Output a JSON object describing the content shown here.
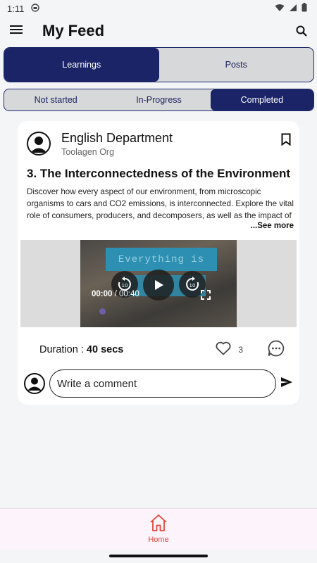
{
  "status": {
    "time": "1:11"
  },
  "header": {
    "title": "My Feed"
  },
  "main_tabs": [
    {
      "label": "Learnings",
      "active": true
    },
    {
      "label": "Posts",
      "active": false
    }
  ],
  "sub_tabs": [
    {
      "label": "Not started",
      "active": false
    },
    {
      "label": "In-Progress",
      "active": false
    },
    {
      "label": "Completed",
      "active": true
    }
  ],
  "post": {
    "author": "English Department",
    "org": "Toolagen Org",
    "title": "3. The Interconnectedness of the Environment",
    "description": "Discover how every aspect of our environment, from microscopic organisms to cars and CO2 emissions, is interconnected. Explore the vital role of consumers, producers, and decomposers, as well as the impact of human activities on our planet.",
    "see_more": "...See more",
    "video": {
      "banner_text": "Everything is",
      "current_time": "00:00",
      "separator": " / ",
      "total_time": "00:40",
      "rewind_seconds": "10",
      "forward_seconds": "10"
    },
    "duration_label": "Duration : ",
    "duration_value": "40 secs",
    "like_count": "3"
  },
  "comment": {
    "placeholder": "Write a comment"
  },
  "bottom_nav": {
    "home_label": "Home"
  },
  "colors": {
    "primary": "#1a2466",
    "accent": "#e2463d",
    "card": "#ffffff",
    "background": "#f3f5f6"
  }
}
